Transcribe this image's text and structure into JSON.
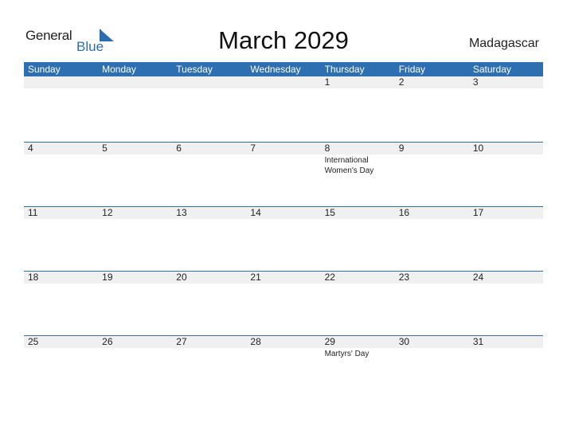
{
  "logo": {
    "part1": "General",
    "part2": "Blue"
  },
  "title": "March 2029",
  "country": "Madagascar",
  "accent": "#2d6fb0",
  "weekdays": [
    "Sunday",
    "Monday",
    "Tuesday",
    "Wednesday",
    "Thursday",
    "Friday",
    "Saturday"
  ],
  "weeks": [
    [
      {
        "d": ""
      },
      {
        "d": ""
      },
      {
        "d": ""
      },
      {
        "d": ""
      },
      {
        "d": "1"
      },
      {
        "d": "2"
      },
      {
        "d": "3"
      }
    ],
    [
      {
        "d": "4"
      },
      {
        "d": "5"
      },
      {
        "d": "6"
      },
      {
        "d": "7"
      },
      {
        "d": "8",
        "ev": "International Women's Day"
      },
      {
        "d": "9"
      },
      {
        "d": "10"
      }
    ],
    [
      {
        "d": "11"
      },
      {
        "d": "12"
      },
      {
        "d": "13"
      },
      {
        "d": "14"
      },
      {
        "d": "15"
      },
      {
        "d": "16"
      },
      {
        "d": "17"
      }
    ],
    [
      {
        "d": "18"
      },
      {
        "d": "19"
      },
      {
        "d": "20"
      },
      {
        "d": "21"
      },
      {
        "d": "22"
      },
      {
        "d": "23"
      },
      {
        "d": "24"
      }
    ],
    [
      {
        "d": "25"
      },
      {
        "d": "26"
      },
      {
        "d": "27"
      },
      {
        "d": "28"
      },
      {
        "d": "29",
        "ev": "Martyrs' Day"
      },
      {
        "d": "30"
      },
      {
        "d": "31"
      }
    ]
  ]
}
